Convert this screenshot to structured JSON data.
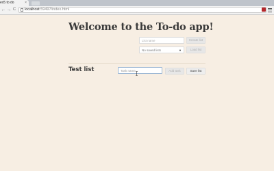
{
  "browser": {
    "tab_title": "ex5 to do",
    "tab_close": "×",
    "url_host": "localhost",
    "url_path": ":59497/index.html",
    "back_glyph": "←",
    "forward_glyph": "→",
    "reload_glyph": "C",
    "ext_icon_color": "#b4282c"
  },
  "page": {
    "title": "Welcome to the To-do app!",
    "create": {
      "list_name_placeholder": "List name",
      "create_button": "Create list"
    },
    "saved": {
      "select_value": "No saved lists",
      "load_button": "Load list"
    },
    "list": {
      "title": "Test list",
      "task_placeholder": "Task name",
      "add_button": "Add task",
      "save_button": "Save list"
    }
  }
}
